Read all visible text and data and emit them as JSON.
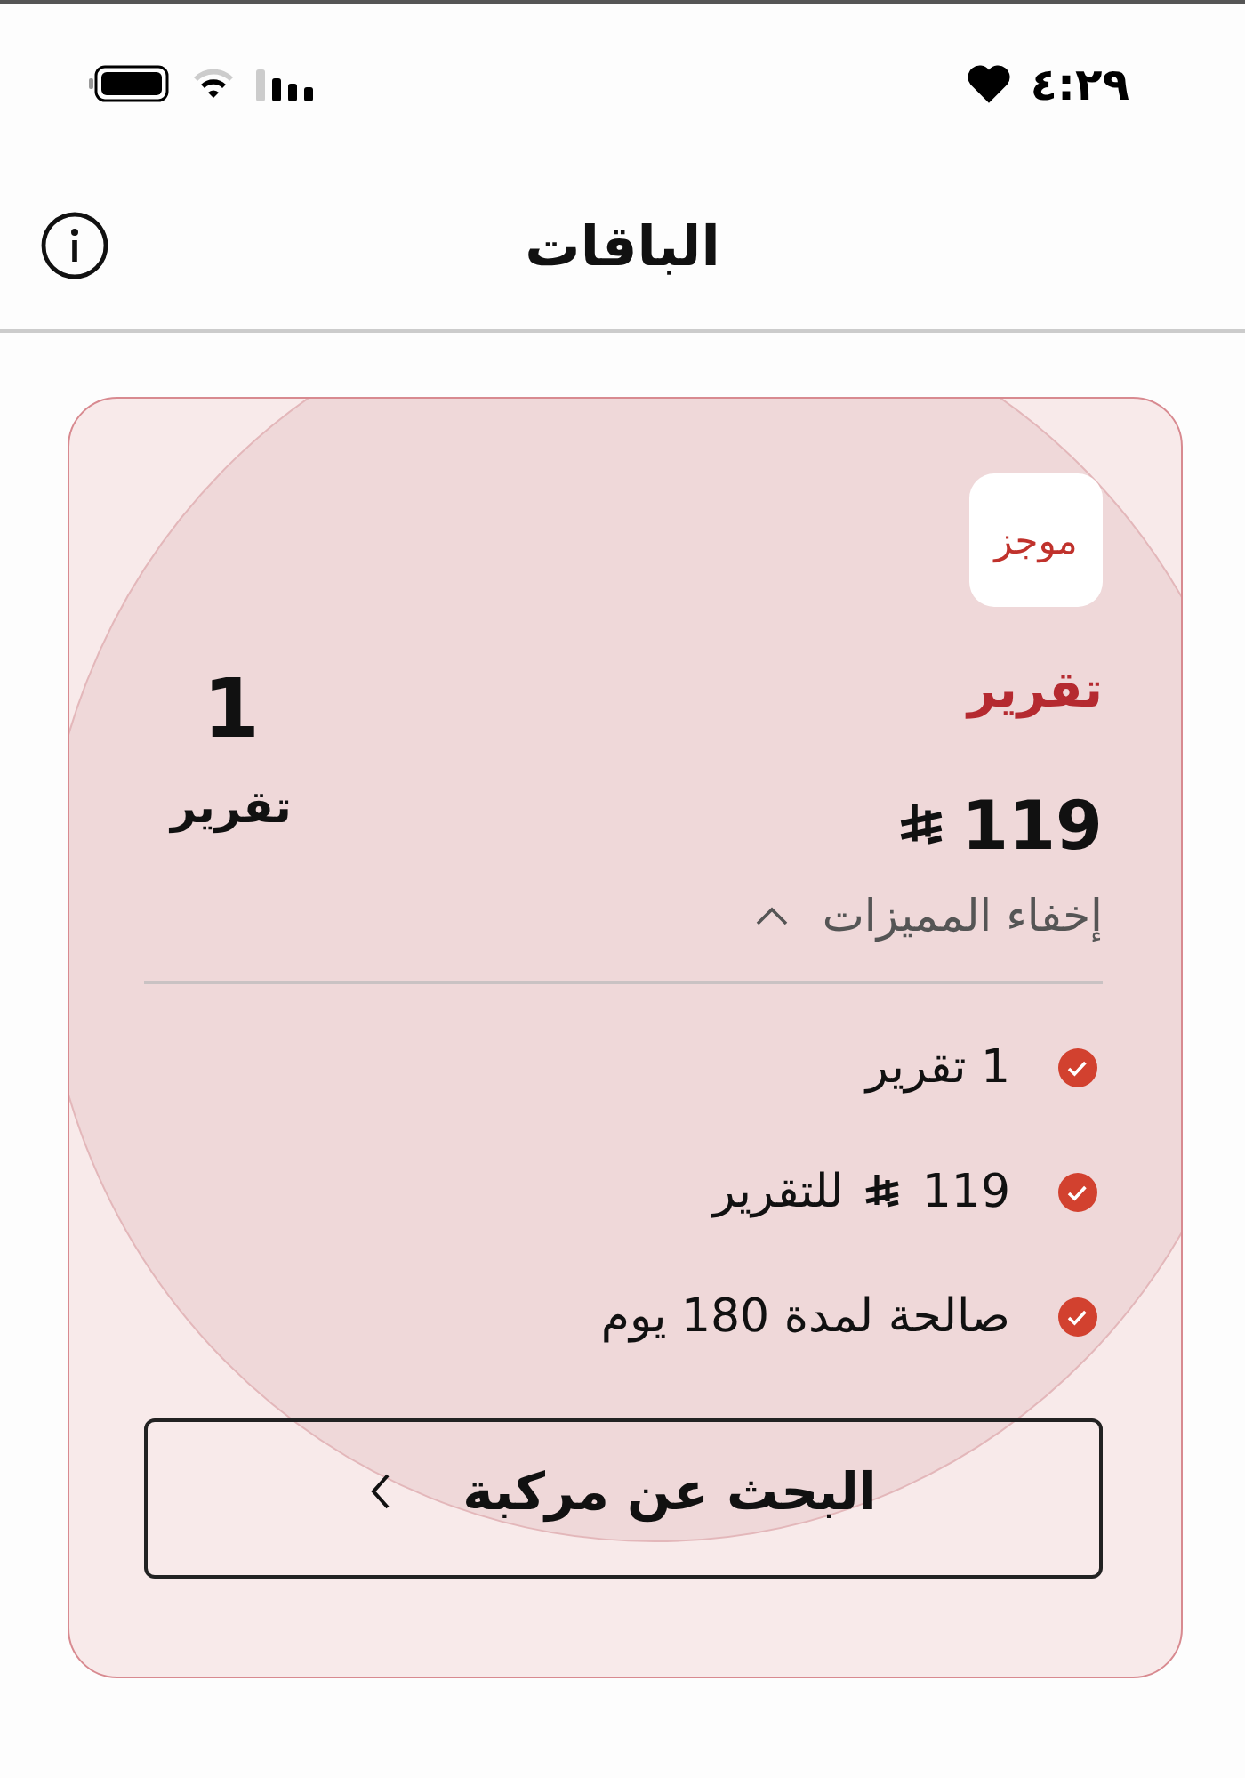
{
  "status_bar": {
    "time": "٤:٢٩"
  },
  "header": {
    "title": "الباقات"
  },
  "package": {
    "logo": "موجز",
    "name": "تقرير",
    "price": "119",
    "count": "1",
    "count_label": "تقرير",
    "features_toggle": {
      "label": "إخفاء المميزات",
      "expanded": true
    },
    "features": [
      {
        "kind": "text",
        "text": "1 تقرير"
      },
      {
        "kind": "price",
        "amount": "119",
        "text": "للتقرير"
      },
      {
        "kind": "text",
        "text": "صالحة لمدة 180 يوم"
      }
    ],
    "action": {
      "label": "البحث عن مركبة"
    }
  }
}
